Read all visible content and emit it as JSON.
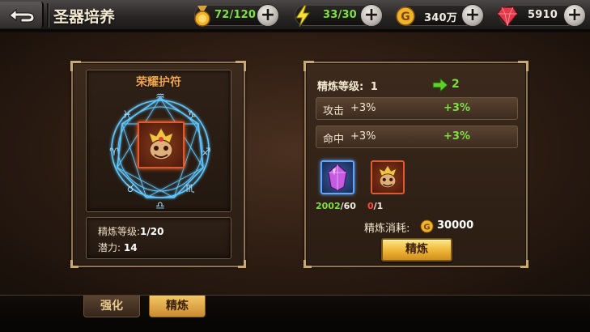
{
  "header": {
    "title": "圣器培养",
    "resources": [
      {
        "icon": "stamina-medal-icon",
        "value": "72/120",
        "color": "#7ee045"
      },
      {
        "icon": "energy-lightning-icon",
        "value": "33/30",
        "color": "#7ee045"
      },
      {
        "icon": "gold-coin-icon",
        "value": "340万",
        "color": "#f0ece4"
      },
      {
        "icon": "red-gem-icon",
        "value": "5910",
        "color": "#f0ece4"
      }
    ]
  },
  "artifact": {
    "name": "荣耀护符",
    "refine_level_label": "精炼等级:",
    "refine_level_value": "1/20",
    "potential_label": "潜力:",
    "potential_value": "14"
  },
  "refine": {
    "level_label": "精炼等级:",
    "current_level": "1",
    "next_level": "2",
    "attributes": [
      {
        "name": "攻击",
        "current": "+3%",
        "next": "+3%"
      },
      {
        "name": "命中",
        "current": "+3%",
        "next": "+3%"
      }
    ],
    "materials": [
      {
        "icon": "purple-crystal-icon",
        "have": "2002",
        "need": "/60",
        "have_color": "#7ee045"
      },
      {
        "icon": "glory-amulet-icon",
        "have": "0",
        "need": "/1",
        "have_color": "#ff4a3a"
      }
    ],
    "cost_label": "精炼消耗:",
    "cost_value": "30000",
    "button_label": "精炼"
  },
  "tabs": [
    {
      "label": "强化",
      "active": false
    },
    {
      "label": "精炼",
      "active": true
    }
  ]
}
